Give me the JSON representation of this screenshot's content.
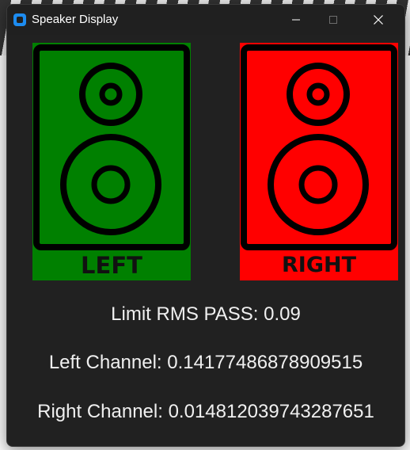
{
  "window": {
    "title": "Speaker Display",
    "icon": "app-window-icon"
  },
  "speakers": {
    "left": {
      "label": "LEFT",
      "color": "#008000",
      "icon": "speaker-icon"
    },
    "right": {
      "label": "RIGHT",
      "color": "#ff0000",
      "icon": "speaker-icon"
    }
  },
  "info": {
    "limit": "Limit RMS PASS: 0.09",
    "left_channel": "Left Channel: 0.14177486878909515",
    "right_channel": "Right Channel: 0.014812039743287651"
  },
  "colors": {
    "window_bg": "#212121",
    "text": "#f0f0f0",
    "pass": "#008000",
    "fail": "#ff0000"
  }
}
